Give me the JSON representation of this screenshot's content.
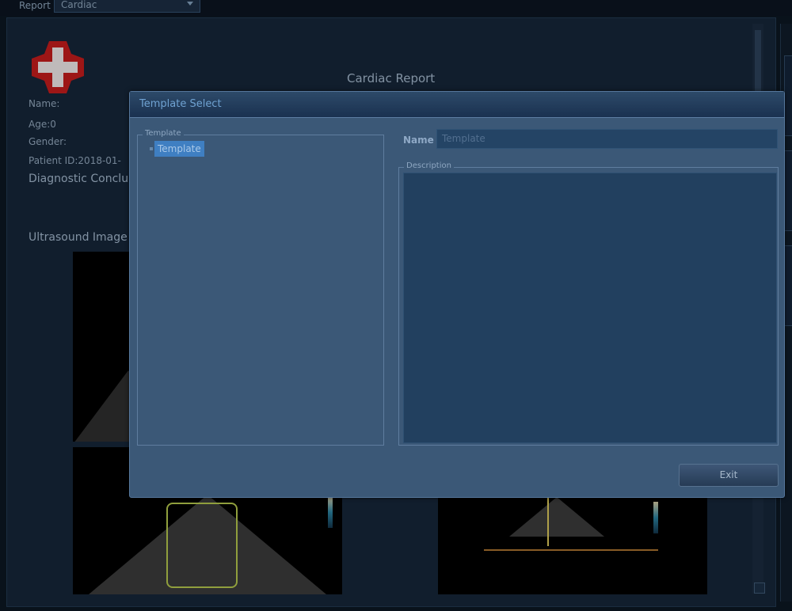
{
  "top": {
    "label": "Report",
    "selected": "Cardiac"
  },
  "report": {
    "title": "Cardiac Report",
    "fields": {
      "name": "Name:",
      "age": "Age:0",
      "gender": "Gender:",
      "patient_id": "Patient ID:2018-01-",
      "diagnostic": "Diagnostic Conclu",
      "ultrasound": "Ultrasound Image"
    }
  },
  "dialog": {
    "title": "Template Select",
    "tree_legend": "Template",
    "tree_item": "Template",
    "name_label": "Name",
    "name_value": "Template",
    "description_legend": "Description",
    "exit_label": "Exit"
  },
  "colors": {
    "dialog_bg": "#3b5877",
    "selection": "#3f7fc2",
    "report_bg": "#152538"
  },
  "icons": [
    "hospital-cross-logo",
    "resize-icon"
  ]
}
